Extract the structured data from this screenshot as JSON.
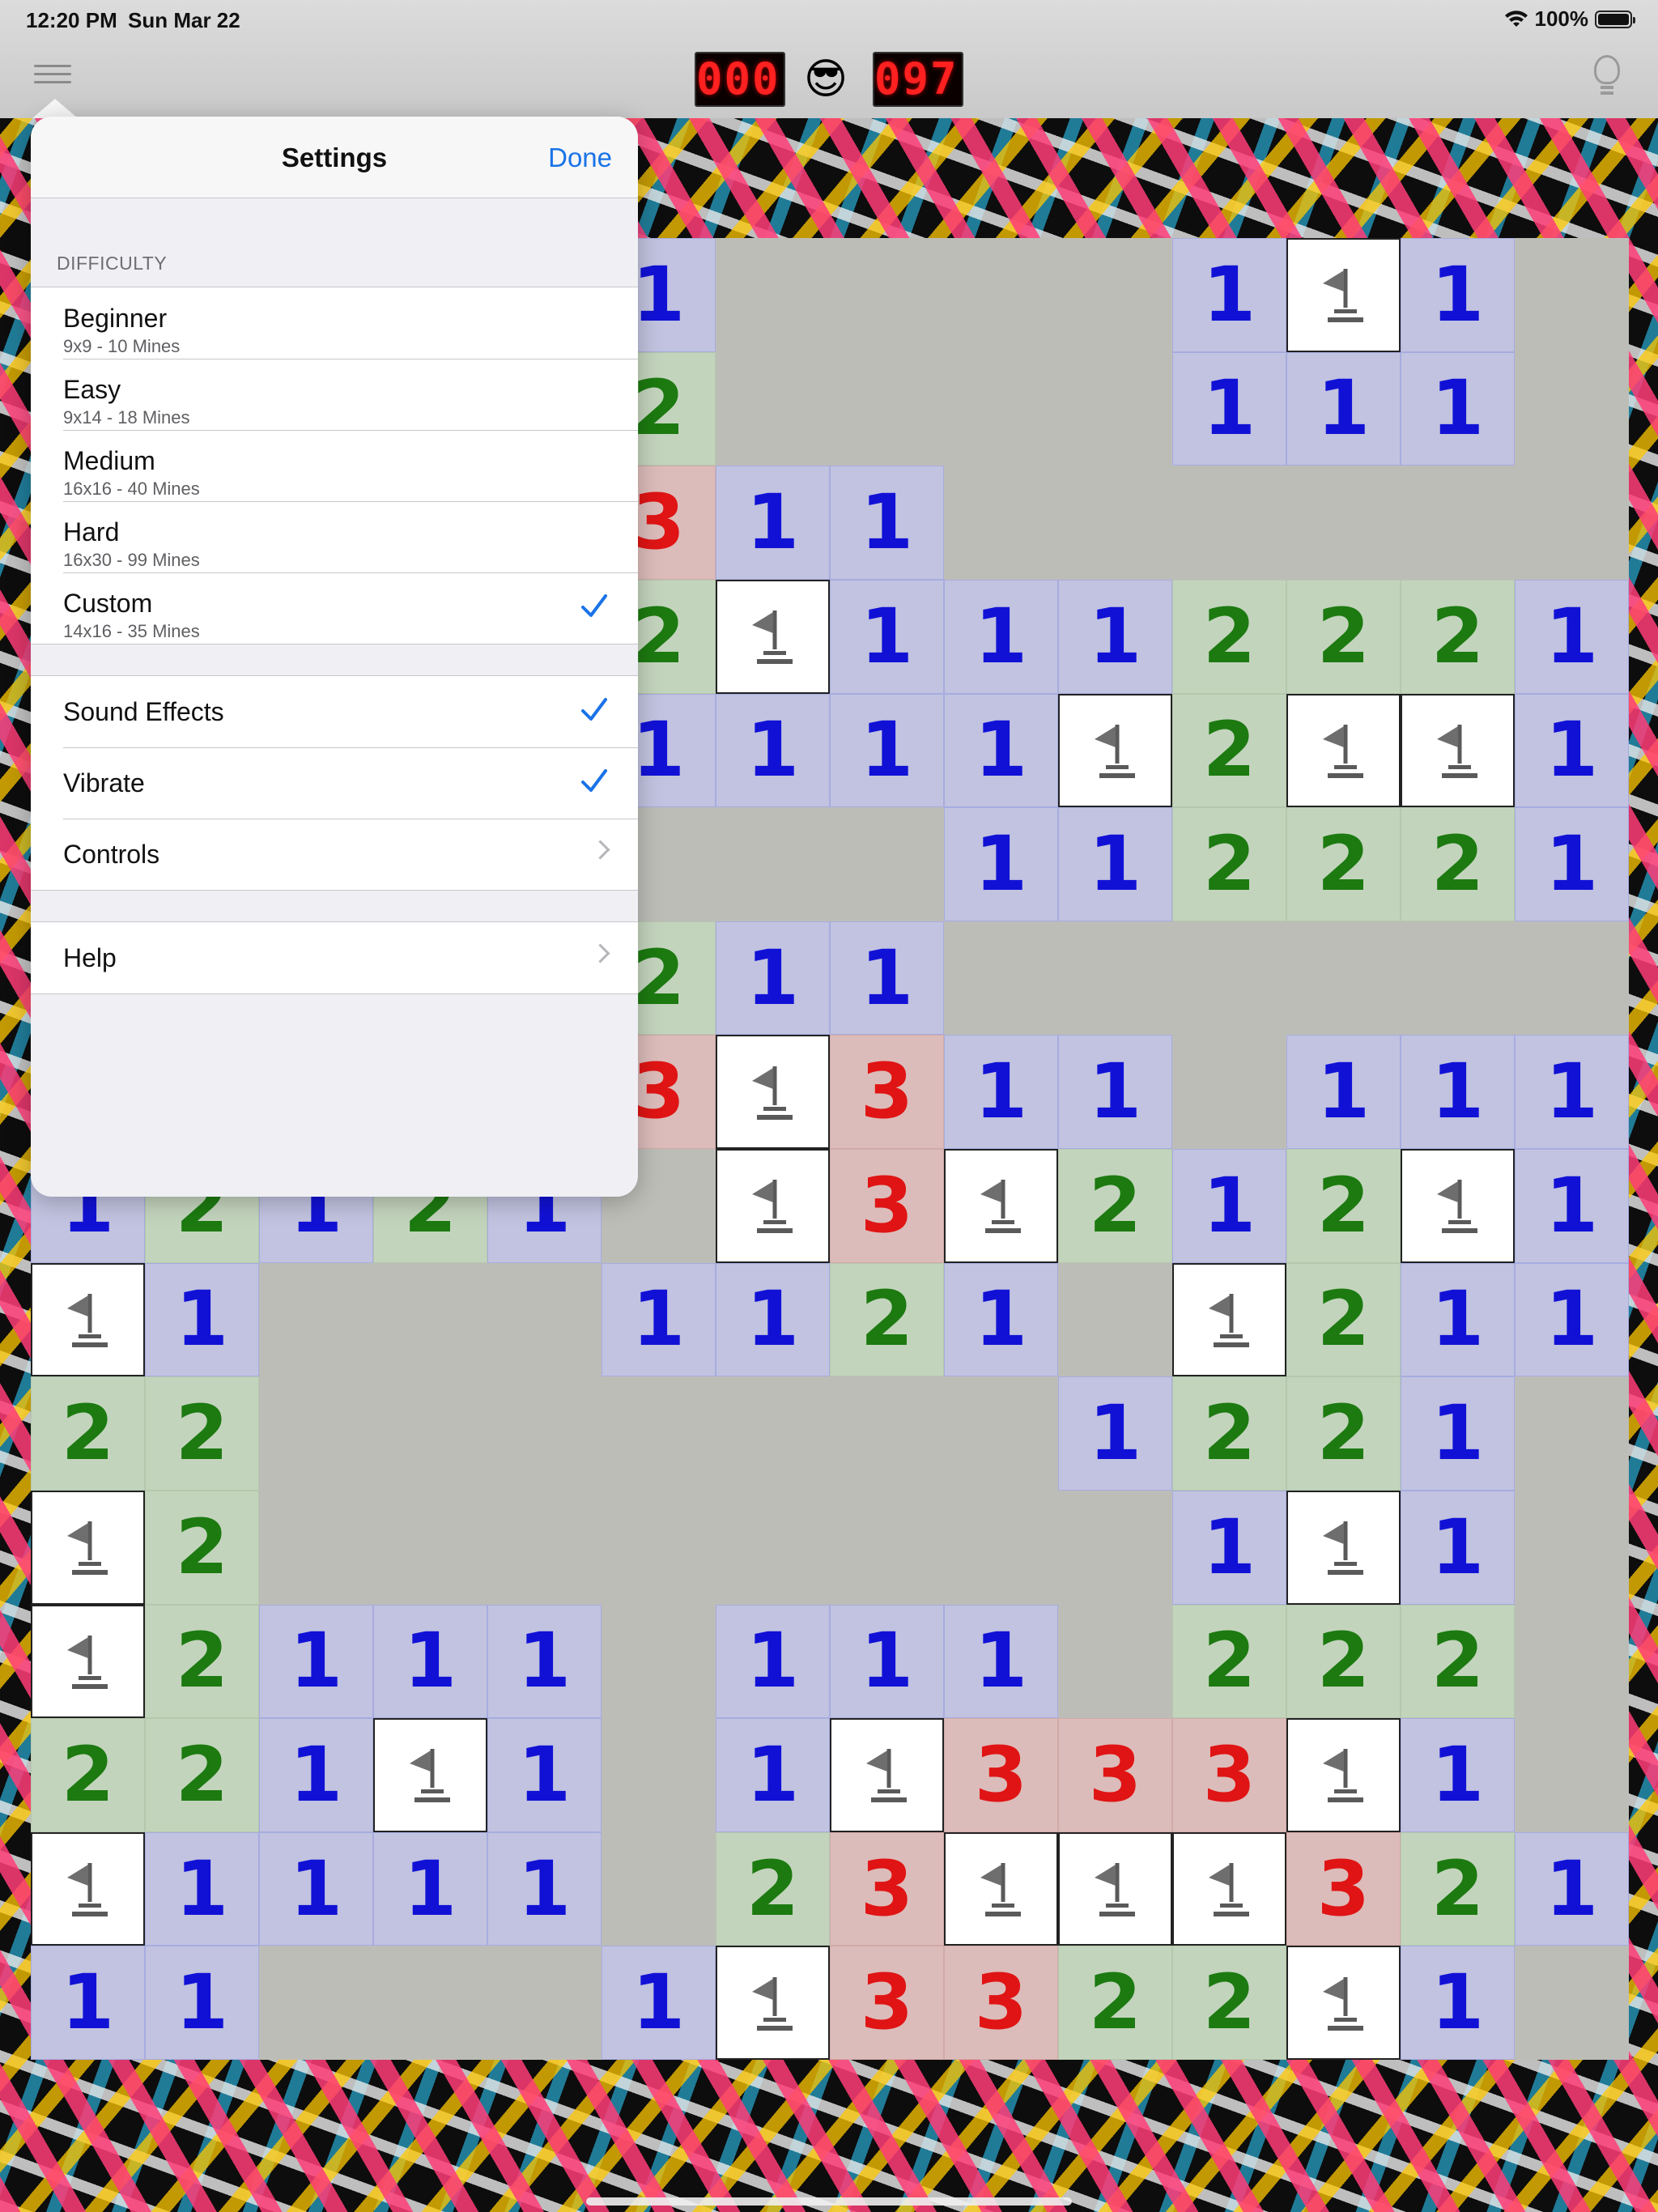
{
  "status_bar": {
    "time": "12:20 PM",
    "date": "Sun Mar 22",
    "battery": "100%"
  },
  "toolbar": {
    "mine_counter": "000",
    "timer": "097",
    "face": "😎"
  },
  "settings": {
    "title": "Settings",
    "done_label": "Done",
    "difficulty_header": "DIFFICULTY",
    "difficulties": [
      {
        "label": "Beginner",
        "detail": "9x9 - 10 Mines",
        "selected": false
      },
      {
        "label": "Easy",
        "detail": "9x14 - 18 Mines",
        "selected": false
      },
      {
        "label": "Medium",
        "detail": "16x16 - 40 Mines",
        "selected": false
      },
      {
        "label": "Hard",
        "detail": "16x30 - 99 Mines",
        "selected": false
      },
      {
        "label": "Custom",
        "detail": "14x16 - 35 Mines",
        "selected": true
      }
    ],
    "options": [
      {
        "label": "Sound Effects",
        "enabled": true
      },
      {
        "label": "Vibrate",
        "enabled": true
      },
      {
        "label": "Controls"
      }
    ],
    "help_label": "Help"
  },
  "board": {
    "cols": 14,
    "rows": 16,
    "legend": {
      "E": "empty-revealed",
      "F": "flag",
      "1": "one",
      "2": "two",
      "3": "three"
    },
    "grid": [
      "EEEEE1EEEE1F1E",
      "EEEEE2EEEE111E",
      "EEEEE311EEEEEE",
      "EEEEE2F1112221",
      "EEEEE1111F2FF1",
      "EEEEEEEE112221",
      "EEEEE211EEEEEE",
      "EEEEE3F311E111",
      "12121 F3F212F1",
      "F1EEE1121 F211",
      "22EEEEEEE1221E",
      "F2EEEEEEEE1F1E",
      "F2111E111E222E",
      "221F1E1F333F1E",
      "F1111E23FFF321",
      "11EEE1F3322F1E"
    ],
    "colors": {
      "one": "#1111d6",
      "two": "#1c7a10",
      "three": "#e01414"
    }
  }
}
